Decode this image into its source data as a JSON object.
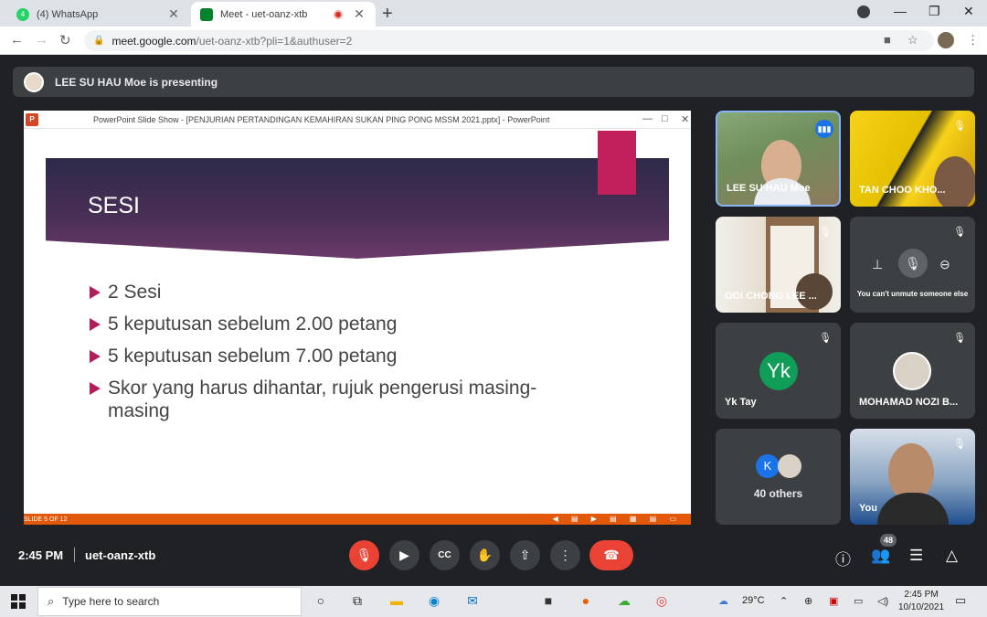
{
  "browser": {
    "tabs": [
      {
        "title": "(4) WhatsApp",
        "badge": "4",
        "active": false
      },
      {
        "title": "Meet - uet-oanz-xtb",
        "active": true
      }
    ],
    "url_host": "meet.google.com",
    "url_path": "/uet-oanz-xtb?pli=1&authuser=2"
  },
  "meet": {
    "presenting_text": "LEE SU HAU Moe is presenting",
    "time": "2:45 PM",
    "meeting_code": "uet-oanz-xtb",
    "participant_count": "48",
    "colors": {
      "end_call": "#ea4335",
      "accent": "#1a73e8",
      "background": "#202124"
    }
  },
  "slideshow": {
    "window_title": "PowerPoint Slide Show - [PENJURIAN PERTANDINGAN KEMAHIRAN SUKAN PING PONG MSSM 2021.pptx] - PowerPoint",
    "heading": "SESI",
    "bullets": [
      "2 Sesi",
      "5 keputusan sebelum 2.00 petang",
      "5 keputusan sebelum 7.00 petang",
      "Skor yang harus dihantar, rujuk pengerusi masing-masing"
    ],
    "status": "SLIDE 5 OF 12"
  },
  "tiles": [
    {
      "name": "LEE SU HAU Moe",
      "speaking": true
    },
    {
      "name": "TAN CHOO KHO...",
      "muted": true
    },
    {
      "name": "OOI CHONG LEE ...",
      "muted": true
    },
    {
      "hover_text": "You can't unmute someone else",
      "muted": true
    },
    {
      "name": "Yk Tay",
      "initials": "Yk",
      "muted": true
    },
    {
      "name": "MOHAMAD NOZI B...",
      "muted": true
    },
    {
      "others_label": "40 others",
      "initial": "K"
    },
    {
      "name": "You",
      "muted": true
    }
  ],
  "taskbar": {
    "search_placeholder": "Type here to search",
    "weather": "29°C",
    "time": "2:45 PM",
    "date": "10/10/2021"
  }
}
